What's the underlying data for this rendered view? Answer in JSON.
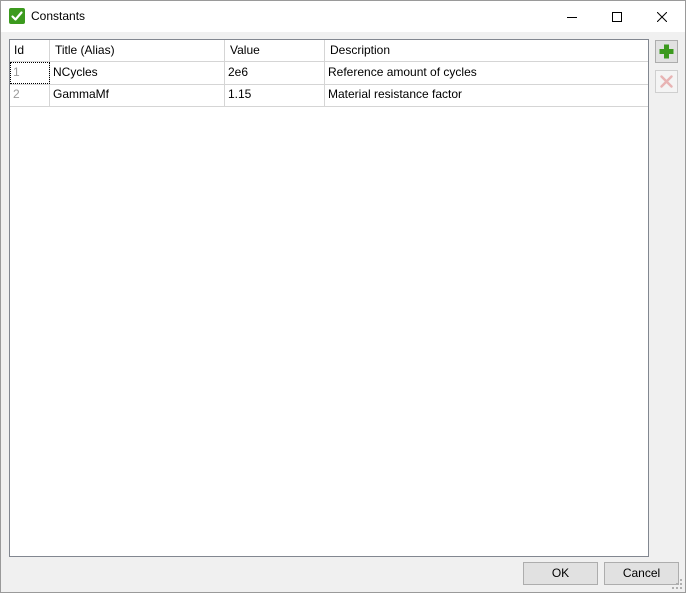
{
  "window": {
    "title": "Constants",
    "icon": "green-checkmark-icon"
  },
  "grid": {
    "columns": [
      "Id",
      "Title (Alias)",
      "Value",
      "Description"
    ],
    "rows": [
      {
        "id": "1",
        "title": "NCycles",
        "value": "2e6",
        "description": "Reference amount of cycles"
      },
      {
        "id": "2",
        "title": "GammaMf",
        "value": "1.15",
        "description": "Material resistance factor"
      }
    ]
  },
  "side_buttons": {
    "add_icon": "plus-icon",
    "delete_icon": "delete-x-icon"
  },
  "buttons": {
    "ok": "OK",
    "cancel": "Cancel"
  },
  "colors": {
    "add": "#3c9a1e",
    "delete_disabled": "#e8b4b4",
    "check": "#3c9a1e"
  }
}
